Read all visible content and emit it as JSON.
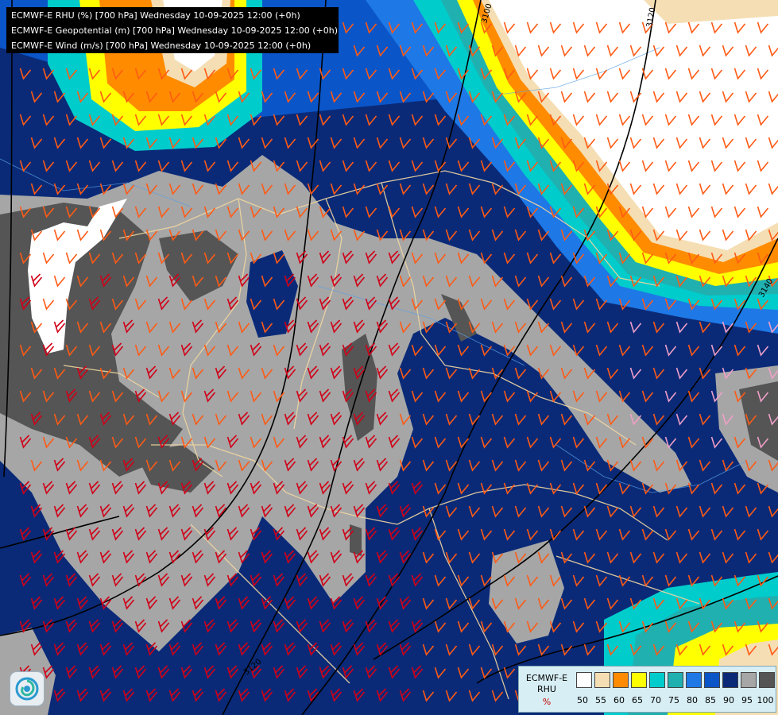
{
  "title_lines": [
    "ECMWF-E RHU (%) [700 hPa] Wednesday 10-09-2025 12:00 (+0h)",
    "ECMWF-E Geopotential (m) [700 hPa] Wednesday 10-09-2025 12:00 (+0h)",
    "ECMWF-E Wind (m/s) [700 hPa] Wednesday 10-09-2025 12:00 (+0h)"
  ],
  "contour_labels": [
    "3100",
    "3120",
    "3140",
    "3120"
  ],
  "legend": {
    "line1": "ECMWF-E",
    "line2": "RHU",
    "unit": "%",
    "ticks": [
      "50",
      "55",
      "60",
      "65",
      "70",
      "75",
      "80",
      "85",
      "90",
      "95",
      "100"
    ],
    "colors": [
      "#ffffff",
      "#f5deb3",
      "#ff8c00",
      "#ffff00",
      "#00cccc",
      "#20b0b0",
      "#1e78e6",
      "#0a55c8",
      "#0a2a78",
      "#a6a6a6",
      "#555555"
    ]
  },
  "palette": {
    "rhu_white": "#ffffff",
    "rhu_wheat": "#f5deb3",
    "rhu_orange": "#ff8c00",
    "rhu_yellow": "#ffff00",
    "rhu_cyan": "#00cccc",
    "rhu_teal": "#20b0b0",
    "rhu_blue": "#1e78e6",
    "rhu_mid_blue": "#0a55c8",
    "rhu_navy": "#0a2a78",
    "rhu_grey": "#a6a6a6",
    "rhu_dark_grey": "#555555",
    "wind_strong": "#d00018",
    "wind_medium": "#ff5a14",
    "wind_weak": "#f0a0c8",
    "borders": "#f0d6a0",
    "contours": "#000000"
  },
  "logo_icon": "ecmwf-swirl-icon"
}
